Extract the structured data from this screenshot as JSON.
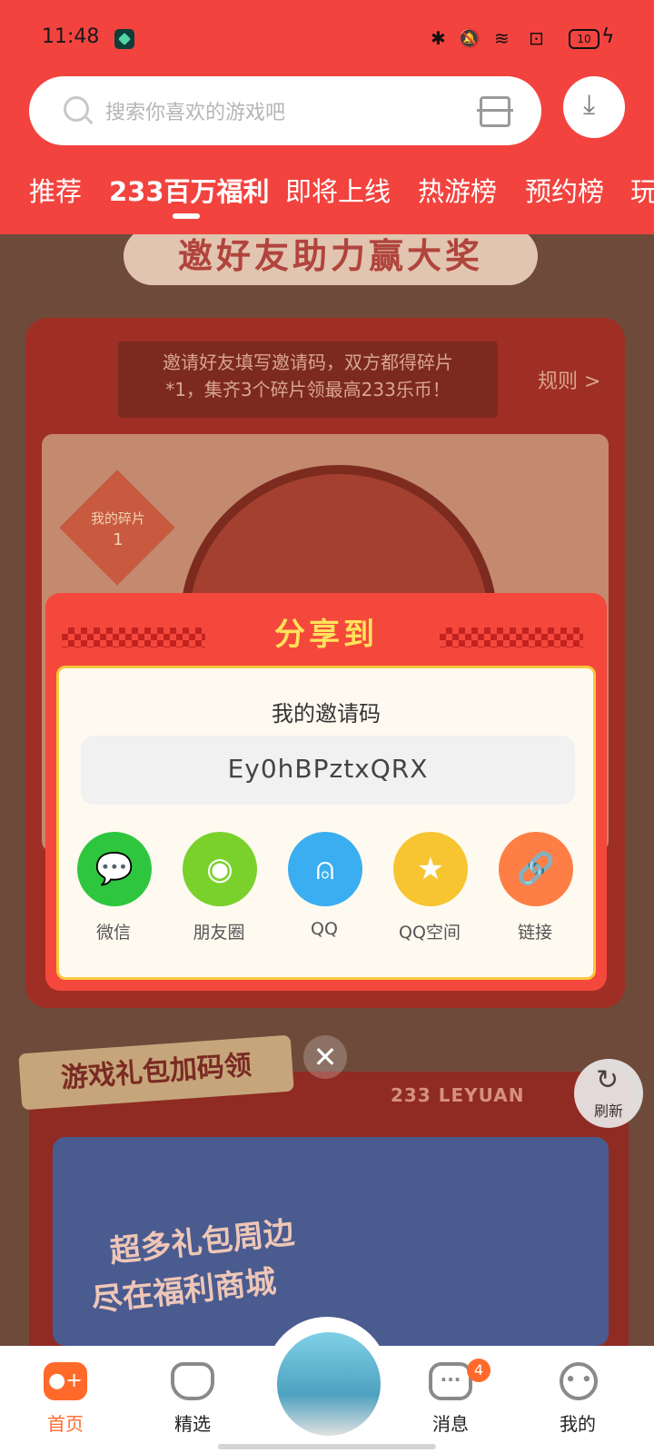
{
  "status_bar": {
    "time": "11:48",
    "battery": "10"
  },
  "search": {
    "placeholder": "搜索你喜欢的游戏吧"
  },
  "tabs": [
    {
      "label": "推荐"
    },
    {
      "label": "233百万福利"
    },
    {
      "label": "即将上线"
    },
    {
      "label": "热游榜"
    },
    {
      "label": "预约榜"
    },
    {
      "label": "玩"
    }
  ],
  "background": {
    "banner_title": "邀好友助力赢大奖",
    "invite_desc_line1": "邀请好友填写邀请码，双方都得碎片",
    "invite_desc_line2": "*1，集齐3个碎片领最高233乐币！",
    "rules_link": "规则 >",
    "fragment_label": "我的碎片",
    "fragment_count": "1",
    "gift_title": "游戏礼包加码领",
    "gift_brand": "233 LEYUAN",
    "gift_headline1": "超多礼包周边",
    "gift_headline2": "尽在福利商城"
  },
  "modal": {
    "title": "分享到",
    "code_label": "我的邀请码",
    "code_value": "Ey0hBPztxQRX",
    "share_targets": [
      {
        "label": "微信",
        "color": "#2fc63f"
      },
      {
        "label": "朋友圈",
        "color": "#7ad12c"
      },
      {
        "label": "QQ",
        "color": "#3aaef0"
      },
      {
        "label": "QQ空间",
        "color": "#f7c531"
      },
      {
        "label": "链接",
        "color": "#ff7e45"
      }
    ]
  },
  "refresh": {
    "label": "刷新"
  },
  "bottom_nav": [
    {
      "label": "首页"
    },
    {
      "label": "精选"
    },
    {
      "label": "消息",
      "badge": "4"
    },
    {
      "label": "我的"
    }
  ]
}
